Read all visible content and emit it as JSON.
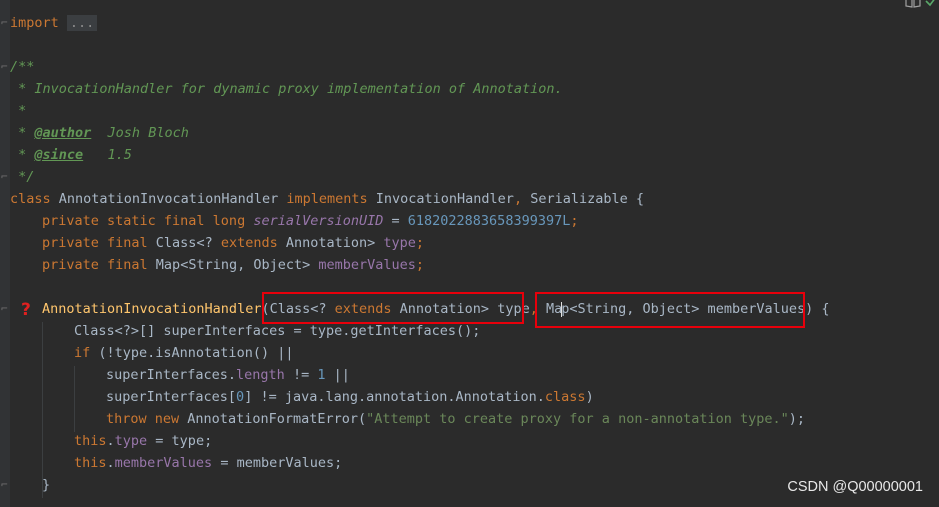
{
  "editor": {
    "import_keyword": "import",
    "import_fold": "...",
    "javadoc": {
      "open": "/**",
      "description": " * InvocationHandler for dynamic proxy implementation of Annotation.",
      "blank": " *",
      "author_prefix": " * ",
      "author_tag": "@author",
      "author_value": "  Josh Bloch",
      "since_prefix": " * ",
      "since_tag": "@since",
      "since_value": "   1.5",
      "close": " */"
    },
    "class_decl": {
      "kw_class": "class",
      "name": " AnnotationInvocationHandler ",
      "kw_implements": "implements",
      "interfaces_1": " InvocationHandler",
      "comma": ",",
      "interfaces_2": " Serializable {"
    },
    "field1": {
      "modifiers": "private static final long",
      "name": "serialVersionUID",
      "eq": " = ",
      "value": "6182022883658399397L",
      "semi": ";"
    },
    "field2": {
      "modifiers": "private final",
      "type_a": " Class<? ",
      "kw_extends": "extends",
      "type_b": " Annotation> ",
      "name": "type",
      "semi": ";"
    },
    "field3": {
      "modifiers": "private final",
      "type_map": " Map",
      "type_rest": "<String, Object> ",
      "name": "memberValues",
      "semi": ";"
    },
    "constructor": {
      "name": "AnnotationInvocationHandler",
      "paren": "(",
      "p1_a": "Class<? ",
      "kw_extends": "extends",
      "p1_b": " Annotation> type",
      "comma": ",",
      "space": " ",
      "p2_ma": "Ma",
      "p2_p": "p",
      "p2_rest": "<String, Object> memberValues",
      "close": ") {"
    },
    "body": {
      "l1": "Class<?>[] superInterfaces = type.getInterfaces();",
      "l2_kw": "if",
      "l2_rest": " (!type.isAnnotation() ||",
      "l3_a": "superInterfaces.",
      "l3_field": "length",
      "l3_b": " != ",
      "l3_num": "1",
      "l3_c": " ||",
      "l4_a": "superInterfaces[",
      "l4_num": "0",
      "l4_b": "] != java.lang.annotation.Annotation.",
      "l4_kw": "class",
      "l4_c": ")",
      "l5_kw1": "throw",
      "l5_sp": " ",
      "l5_kw2": "new",
      "l5_a": " AnnotationFormatError(",
      "l5_str": "\"Attempt to create proxy for a non-annotation type.\"",
      "l5_b": ");",
      "l6_kw": "this",
      "l6_dot": ".",
      "l6_field": "type",
      "l6_rest": " = type;",
      "l7_kw": "this",
      "l7_dot": ".",
      "l7_field": "memberValues",
      "l7_rest": " = memberValues;",
      "l8": "}"
    }
  },
  "watermark": "CSDN @Q00000001",
  "icons": {
    "error_marker": "question-mark-icon",
    "reader_mode": "book-icon",
    "inspection": "check-icon"
  },
  "colors": {
    "background": "#2b2b2b",
    "keyword": "#cc7832",
    "comment": "#629755",
    "field": "#9876aa",
    "number": "#6897bb",
    "string": "#6a8759",
    "method": "#ffc66d",
    "highlight_box": "#e8000b"
  }
}
